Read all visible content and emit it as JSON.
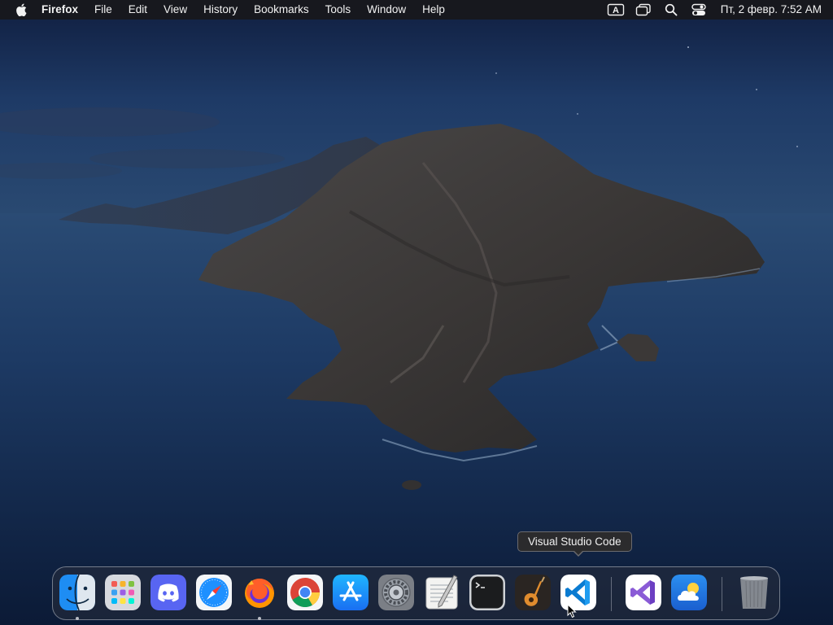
{
  "menubar": {
    "apple_icon": "apple-logo-icon",
    "app_name": "Firefox",
    "menus": [
      "File",
      "Edit",
      "View",
      "History",
      "Bookmarks",
      "Tools",
      "Window",
      "Help"
    ],
    "status_icons": [
      "input-source-icon",
      "screen-mirroring-icon",
      "spotlight-search-icon",
      "control-center-icon"
    ],
    "input_source_letter": "A",
    "clock": "Пт, 2 февр.  7:52 AM"
  },
  "tooltip": {
    "text": "Visual Studio Code"
  },
  "dock": {
    "apps": [
      {
        "name": "Finder",
        "icon": "finder-icon",
        "running": true
      },
      {
        "name": "Launchpad",
        "icon": "launchpad-icon",
        "running": false
      },
      {
        "name": "Discord",
        "icon": "discord-icon",
        "running": false
      },
      {
        "name": "Safari",
        "icon": "safari-icon",
        "running": false
      },
      {
        "name": "Firefox",
        "icon": "firefox-icon",
        "running": true
      },
      {
        "name": "Google Chrome",
        "icon": "chrome-icon",
        "running": false
      },
      {
        "name": "App Store",
        "icon": "app-store-icon",
        "running": false
      },
      {
        "name": "System Preferences",
        "icon": "system-preferences-icon",
        "running": false
      },
      {
        "name": "TextEdit",
        "icon": "textedit-icon",
        "running": false
      },
      {
        "name": "Terminal",
        "icon": "terminal-icon",
        "running": false
      },
      {
        "name": "GarageBand",
        "icon": "garageband-icon",
        "running": false
      },
      {
        "name": "Visual Studio Code",
        "icon": "vscode-icon",
        "running": false
      }
    ],
    "recent_apps": [
      {
        "name": "Visual Studio",
        "icon": "visual-studio-icon",
        "running": false
      },
      {
        "name": "Weather",
        "icon": "weather-icon",
        "running": false
      }
    ],
    "trash": {
      "name": "Trash",
      "icon": "trash-icon"
    }
  },
  "colors": {
    "menubar_bg": "#18181b",
    "sky_top": "#13244a",
    "sea": "#14305c",
    "island": "#3a3736",
    "dock_border": "#bec3cd"
  }
}
